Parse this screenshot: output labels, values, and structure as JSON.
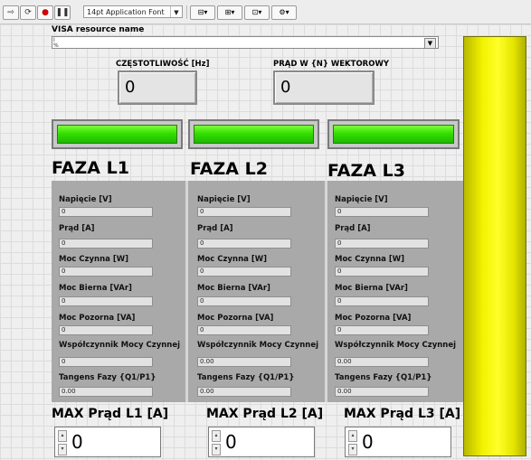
{
  "toolbar": {
    "font_label": "14pt Application Font"
  },
  "visa": {
    "label": "VISA resource name",
    "value": ""
  },
  "frequency": {
    "label": "CZĘSTOTLIWOŚĆ [Hz]",
    "value": "0"
  },
  "vector_current": {
    "label": "PRĄD W {N} WEKTOROWY",
    "value": "0"
  },
  "phases": [
    {
      "title": "FAZA L1",
      "fields": [
        {
          "label": "Napięcie  [V]",
          "value": "0"
        },
        {
          "label": "Prąd  [A]",
          "value": "0"
        },
        {
          "label": "Moc Czynna [W]",
          "value": "0"
        },
        {
          "label": "Moc Bierna [VAr]",
          "value": "0"
        },
        {
          "label": "Moc Pozorna [VA]",
          "value": "0"
        },
        {
          "label": "Współczynnik Mocy Czynnej",
          "value": "0"
        },
        {
          "label": "Tangens Fazy  {Q1/P1}",
          "value": "0.00"
        }
      ],
      "max_label": "MAX Prąd L1 [A]",
      "max_value": "0"
    },
    {
      "title": "FAZA L2",
      "fields": [
        {
          "label": "Napięcie  [V]",
          "value": "0"
        },
        {
          "label": "Prąd  [A]",
          "value": "0"
        },
        {
          "label": "Moc Czynna [W]",
          "value": "0"
        },
        {
          "label": "Moc Bierna [VAr]",
          "value": "0"
        },
        {
          "label": "Moc Pozorna [VA]",
          "value": "0"
        },
        {
          "label": "Współczynnik Mocy Czynnej",
          "value": "0.00"
        },
        {
          "label": "Tangens Fazy  {Q1/P1}",
          "value": "0.00"
        }
      ],
      "max_label": "MAX Prąd L2 [A]",
      "max_value": "0"
    },
    {
      "title": "FAZA L3",
      "fields": [
        {
          "label": "Napięcie  [V]",
          "value": "0"
        },
        {
          "label": "Prąd  [A]",
          "value": "0"
        },
        {
          "label": "Moc Czynna [W]",
          "value": "0"
        },
        {
          "label": "Moc Bierna [VAr]",
          "value": "0"
        },
        {
          "label": "Moc Pozorna [VA]",
          "value": "0"
        },
        {
          "label": "Współczynnik Mocy Czynnej",
          "value": "0.00"
        },
        {
          "label": "Tangens Fazy  {Q1/P1}",
          "value": "0.00"
        }
      ],
      "max_label": "MAX Prąd L3 [A]",
      "max_value": "0"
    }
  ],
  "colors": {
    "led_on": "#33e000",
    "yellow_bar": "#f2f200",
    "phase_panel": "#a9a9a9"
  }
}
